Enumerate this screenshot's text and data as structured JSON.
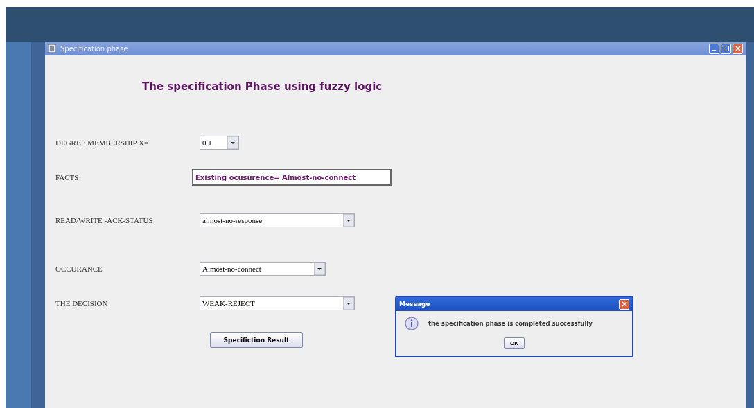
{
  "window": {
    "title": "Specification phase"
  },
  "heading": "The specification Phase using fuzzy logic",
  "fields": [
    {
      "kind": "combo",
      "label": "DEGREE MEMBERSHIP X=",
      "value": "0.1"
    },
    {
      "kind": "text",
      "label": "FACTS",
      "value": "Existing ocusurence= Almost-no-connect"
    },
    {
      "kind": "combo",
      "label": "READ/WRITE -ACK-STATUS",
      "value": "almost-no-response"
    },
    {
      "kind": "combo",
      "label": "OCCURANCE",
      "value": "Almost-no-connect"
    },
    {
      "kind": "combo",
      "label": "THE DECISION",
      "value": "WEAK-REJECT"
    }
  ],
  "button": "Specifiction Result",
  "dialog": {
    "title": "Message",
    "message": "the specification phase is completed successfully",
    "button": "OK"
  }
}
